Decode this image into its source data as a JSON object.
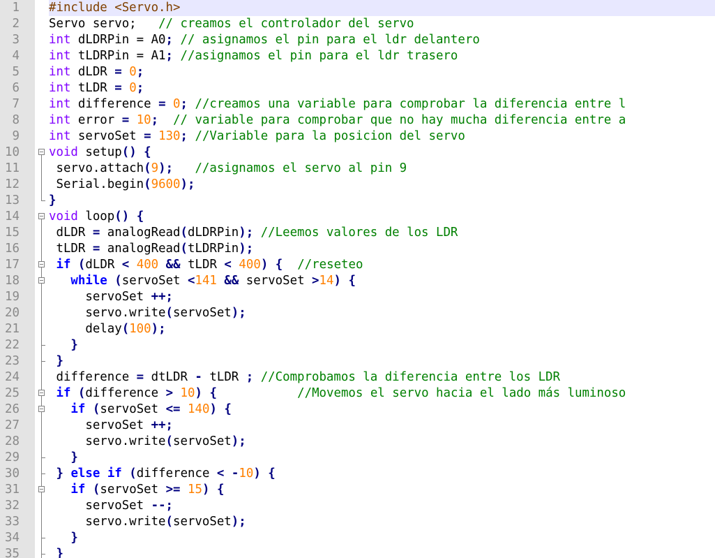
{
  "editor": {
    "current_line": 1,
    "lines": [
      {
        "n": "1",
        "fold": "none",
        "tokens": [
          [
            "pp",
            "#include <Servo.h>"
          ]
        ]
      },
      {
        "n": "2",
        "fold": "none",
        "tokens": [
          [
            "",
            "Servo servo;   "
          ],
          [
            "c",
            "// creamos el controlador del servo"
          ]
        ]
      },
      {
        "n": "3",
        "fold": "none",
        "tokens": [
          [
            "t",
            "int"
          ],
          [
            "",
            " dLDRPin = A0"
          ],
          [
            "p",
            ";"
          ],
          [
            "",
            " "
          ],
          [
            "c",
            "// asignamos el pin para el ldr delantero"
          ]
        ]
      },
      {
        "n": "4",
        "fold": "none",
        "tokens": [
          [
            "t",
            "int"
          ],
          [
            "",
            " tLDRPin = A1"
          ],
          [
            "p",
            ";"
          ],
          [
            "",
            " "
          ],
          [
            "c",
            "//asignamos el pin para el ldr trasero"
          ]
        ]
      },
      {
        "n": "5",
        "fold": "none",
        "tokens": [
          [
            "t",
            "int"
          ],
          [
            "",
            " dLDR "
          ],
          [
            "p",
            "="
          ],
          [
            "",
            " "
          ],
          [
            "n",
            "0"
          ],
          [
            "p",
            ";"
          ]
        ]
      },
      {
        "n": "6",
        "fold": "none",
        "tokens": [
          [
            "t",
            "int"
          ],
          [
            "",
            " tLDR "
          ],
          [
            "p",
            "="
          ],
          [
            "",
            " "
          ],
          [
            "n",
            "0"
          ],
          [
            "p",
            ";"
          ]
        ]
      },
      {
        "n": "7",
        "fold": "none",
        "tokens": [
          [
            "t",
            "int"
          ],
          [
            "",
            " difference "
          ],
          [
            "p",
            "="
          ],
          [
            "",
            " "
          ],
          [
            "n",
            "0"
          ],
          [
            "p",
            ";"
          ],
          [
            "",
            " "
          ],
          [
            "c",
            "//creamos una variable para comprobar la diferencia entre l"
          ]
        ]
      },
      {
        "n": "8",
        "fold": "none",
        "tokens": [
          [
            "t",
            "int"
          ],
          [
            "",
            " error "
          ],
          [
            "p",
            "="
          ],
          [
            "",
            " "
          ],
          [
            "n",
            "10"
          ],
          [
            "p",
            ";"
          ],
          [
            "",
            "  "
          ],
          [
            "c",
            "// variable para comprobar que no hay mucha diferencia entre a"
          ]
        ]
      },
      {
        "n": "9",
        "fold": "none",
        "tokens": [
          [
            "t",
            "int"
          ],
          [
            "",
            " servoSet "
          ],
          [
            "p",
            "="
          ],
          [
            "",
            " "
          ],
          [
            "n",
            "130"
          ],
          [
            "p",
            ";"
          ],
          [
            "",
            " "
          ],
          [
            "c",
            "//Variable para la posicion del servo"
          ]
        ]
      },
      {
        "n": "10",
        "fold": "open",
        "tokens": [
          [
            "t",
            "void"
          ],
          [
            "",
            " setup"
          ],
          [
            "p",
            "()"
          ],
          [
            "",
            " "
          ],
          [
            "p",
            "{"
          ]
        ]
      },
      {
        "n": "11",
        "fold": "line",
        "tokens": [
          [
            "",
            " servo.attach"
          ],
          [
            "p",
            "("
          ],
          [
            "n",
            "9"
          ],
          [
            "p",
            ");"
          ],
          [
            "",
            "   "
          ],
          [
            "c",
            "//asignamos el servo al pin 9"
          ]
        ]
      },
      {
        "n": "12",
        "fold": "line",
        "tokens": [
          [
            "",
            " Serial.begin"
          ],
          [
            "p",
            "("
          ],
          [
            "n",
            "9600"
          ],
          [
            "p",
            ");"
          ]
        ]
      },
      {
        "n": "13",
        "fold": "end",
        "tokens": [
          [
            "p",
            "}"
          ]
        ]
      },
      {
        "n": "14",
        "fold": "open",
        "tokens": [
          [
            "t",
            "void"
          ],
          [
            "",
            " loop"
          ],
          [
            "p",
            "()"
          ],
          [
            "",
            " "
          ],
          [
            "p",
            "{"
          ]
        ]
      },
      {
        "n": "15",
        "fold": "line",
        "tokens": [
          [
            "",
            " dLDR "
          ],
          [
            "p",
            "="
          ],
          [
            "",
            " analogRead"
          ],
          [
            "p",
            "("
          ],
          [
            "",
            "dLDRPin"
          ],
          [
            "p",
            ");"
          ],
          [
            "",
            " "
          ],
          [
            "c",
            "//Leemos valores de los LDR"
          ]
        ]
      },
      {
        "n": "16",
        "fold": "line",
        "tokens": [
          [
            "",
            " tLDR "
          ],
          [
            "p",
            "="
          ],
          [
            "",
            " analogRead"
          ],
          [
            "p",
            "("
          ],
          [
            "",
            "tLDRPin"
          ],
          [
            "p",
            ");"
          ]
        ]
      },
      {
        "n": "17",
        "fold": "open-inner",
        "tokens": [
          [
            "",
            " "
          ],
          [
            "k",
            "if"
          ],
          [
            "",
            " "
          ],
          [
            "p",
            "("
          ],
          [
            "",
            "dLDR "
          ],
          [
            "p",
            "<"
          ],
          [
            "",
            " "
          ],
          [
            "n",
            "400"
          ],
          [
            "",
            " "
          ],
          [
            "p",
            "&&"
          ],
          [
            "",
            " tLDR "
          ],
          [
            "p",
            "<"
          ],
          [
            "",
            " "
          ],
          [
            "n",
            "400"
          ],
          [
            "p",
            ")"
          ],
          [
            "",
            " "
          ],
          [
            "p",
            "{"
          ],
          [
            "",
            "  "
          ],
          [
            "c",
            "//reseteo"
          ]
        ]
      },
      {
        "n": "18",
        "fold": "open-inner",
        "tokens": [
          [
            "",
            "   "
          ],
          [
            "k",
            "while"
          ],
          [
            "",
            " "
          ],
          [
            "p",
            "("
          ],
          [
            "",
            "servoSet "
          ],
          [
            "p",
            "<"
          ],
          [
            "n",
            "141"
          ],
          [
            "",
            " "
          ],
          [
            "p",
            "&&"
          ],
          [
            "",
            " servoSet "
          ],
          [
            "p",
            ">"
          ],
          [
            "n",
            "14"
          ],
          [
            "p",
            ")"
          ],
          [
            "",
            " "
          ],
          [
            "p",
            "{"
          ]
        ]
      },
      {
        "n": "19",
        "fold": "line",
        "tokens": [
          [
            "",
            "     servoSet "
          ],
          [
            "p",
            "++;"
          ]
        ]
      },
      {
        "n": "20",
        "fold": "line",
        "tokens": [
          [
            "",
            "     servo.write"
          ],
          [
            "p",
            "("
          ],
          [
            "",
            "servoSet"
          ],
          [
            "p",
            ");"
          ]
        ]
      },
      {
        "n": "21",
        "fold": "line",
        "tokens": [
          [
            "",
            "     delay"
          ],
          [
            "p",
            "("
          ],
          [
            "n",
            "100"
          ],
          [
            "p",
            ");"
          ]
        ]
      },
      {
        "n": "22",
        "fold": "tick",
        "tokens": [
          [
            "",
            "   "
          ],
          [
            "p",
            "}"
          ]
        ]
      },
      {
        "n": "23",
        "fold": "tick",
        "tokens": [
          [
            "",
            " "
          ],
          [
            "p",
            "}"
          ]
        ]
      },
      {
        "n": "24",
        "fold": "line",
        "tokens": [
          [
            "",
            " difference "
          ],
          [
            "p",
            "="
          ],
          [
            "",
            " dtLDR "
          ],
          [
            "p",
            "-"
          ],
          [
            "",
            " tLDR "
          ],
          [
            "p",
            ";"
          ],
          [
            "",
            " "
          ],
          [
            "c",
            "//Comprobamos la diferencia entre los LDR"
          ]
        ]
      },
      {
        "n": "25",
        "fold": "open-inner",
        "tokens": [
          [
            "",
            " "
          ],
          [
            "k",
            "if"
          ],
          [
            "",
            " "
          ],
          [
            "p",
            "("
          ],
          [
            "",
            "difference "
          ],
          [
            "p",
            ">"
          ],
          [
            "",
            " "
          ],
          [
            "n",
            "10"
          ],
          [
            "p",
            ")"
          ],
          [
            "",
            " "
          ],
          [
            "p",
            "{"
          ],
          [
            "",
            "           "
          ],
          [
            "c",
            "//Movemos el servo hacia el lado más luminoso"
          ]
        ]
      },
      {
        "n": "26",
        "fold": "open-inner",
        "tokens": [
          [
            "",
            "   "
          ],
          [
            "k",
            "if"
          ],
          [
            "",
            " "
          ],
          [
            "p",
            "("
          ],
          [
            "",
            "servoSet "
          ],
          [
            "p",
            "<="
          ],
          [
            "",
            " "
          ],
          [
            "n",
            "140"
          ],
          [
            "p",
            ")"
          ],
          [
            "",
            " "
          ],
          [
            "p",
            "{"
          ]
        ]
      },
      {
        "n": "27",
        "fold": "line",
        "tokens": [
          [
            "",
            "     servoSet "
          ],
          [
            "p",
            "++;"
          ]
        ]
      },
      {
        "n": "28",
        "fold": "line",
        "tokens": [
          [
            "",
            "     servo.write"
          ],
          [
            "p",
            "("
          ],
          [
            "",
            "servoSet"
          ],
          [
            "p",
            ");"
          ]
        ]
      },
      {
        "n": "29",
        "fold": "tick",
        "tokens": [
          [
            "",
            "   "
          ],
          [
            "p",
            "}"
          ]
        ]
      },
      {
        "n": "30",
        "fold": "tick",
        "tokens": [
          [
            "",
            " "
          ],
          [
            "p",
            "}"
          ],
          [
            "",
            " "
          ],
          [
            "k",
            "else"
          ],
          [
            "",
            " "
          ],
          [
            "k",
            "if"
          ],
          [
            "",
            " "
          ],
          [
            "p",
            "("
          ],
          [
            "",
            "difference "
          ],
          [
            "p",
            "<"
          ],
          [
            "",
            " "
          ],
          [
            "p",
            "-"
          ],
          [
            "n",
            "10"
          ],
          [
            "p",
            ")"
          ],
          [
            "",
            " "
          ],
          [
            "p",
            "{"
          ]
        ]
      },
      {
        "n": "31",
        "fold": "open-inner",
        "tokens": [
          [
            "",
            "   "
          ],
          [
            "k",
            "if"
          ],
          [
            "",
            " "
          ],
          [
            "p",
            "("
          ],
          [
            "",
            "servoSet "
          ],
          [
            "p",
            ">="
          ],
          [
            "",
            " "
          ],
          [
            "n",
            "15"
          ],
          [
            "p",
            ")"
          ],
          [
            "",
            " "
          ],
          [
            "p",
            "{"
          ]
        ]
      },
      {
        "n": "32",
        "fold": "line",
        "tokens": [
          [
            "",
            "     servoSet "
          ],
          [
            "p",
            "--;"
          ]
        ]
      },
      {
        "n": "33",
        "fold": "line",
        "tokens": [
          [
            "",
            "     servo.write"
          ],
          [
            "p",
            "("
          ],
          [
            "",
            "servoSet"
          ],
          [
            "p",
            ");"
          ]
        ]
      },
      {
        "n": "34",
        "fold": "tick",
        "tokens": [
          [
            "",
            "   "
          ],
          [
            "p",
            "}"
          ]
        ]
      },
      {
        "n": "35",
        "fold": "tick",
        "tokens": [
          [
            "",
            " "
          ],
          [
            "p",
            "}"
          ]
        ]
      }
    ]
  }
}
